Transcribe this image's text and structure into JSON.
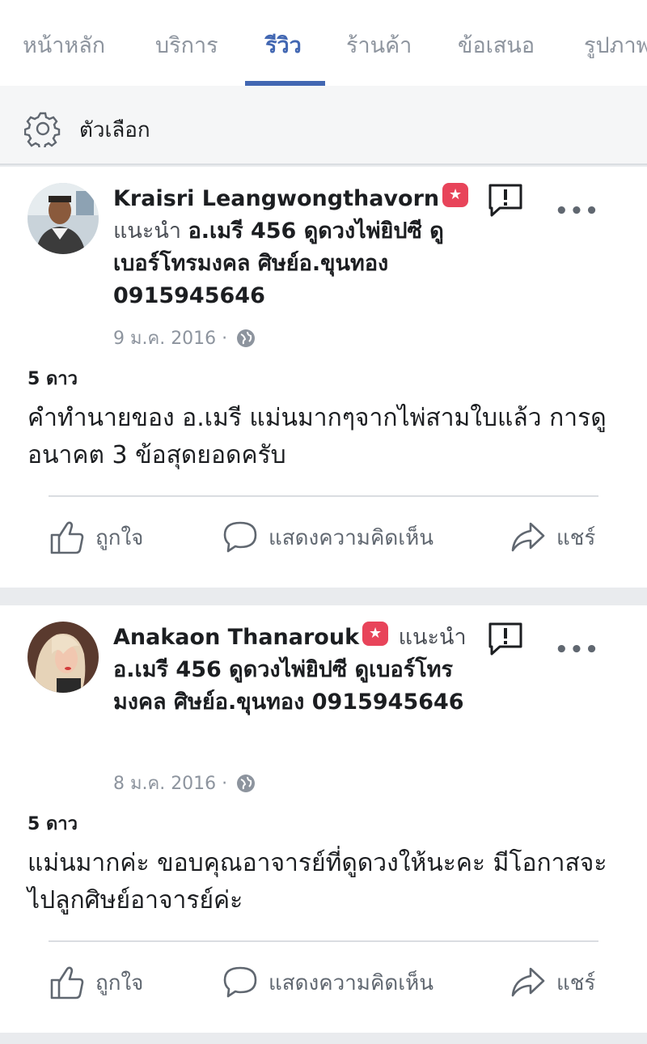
{
  "tabs": [
    "หน้าหลัก",
    "บริการ",
    "รีวิว",
    "ร้านค้า",
    "ข้อเสนอ",
    "รูปภาพ"
  ],
  "active_tab": "รีวิว",
  "options": {
    "label": "ตัวเลือก",
    "icon": "gear-icon"
  },
  "accent_color": "#4267b2",
  "badge_color": "#e8445a",
  "reviews": [
    {
      "author": "Kraisri Leangwongthavorn",
      "recommend_word": "แนะนำ",
      "page_name": "อ.เมรี 456 ดูดวงไพ่ยิปซี ดูเบอร์โทรมงคล ศิษย์อ.ขุนทอง 0915945646",
      "date": "9 ม.ค. 2016 ·",
      "rating": "5 ดาว",
      "text": "คำทำนายของ อ.เมรี แม่นมากๆจากไพ่สามใบแล้ว การดูอนาคต 3 ข้อสุดยอดครับ"
    },
    {
      "author": "Anakaon Thanarouk",
      "recommend_word": "แนะนำ",
      "page_name": "อ.เมรี 456 ดูดวงไพ่ยิปซี ดูเบอร์โทรมงคล ศิษย์อ.ขุนทอง 0915945646",
      "date": "8 ม.ค. 2016 ·",
      "rating": "5 ดาว",
      "text": "แม่นมากค่ะ ขอบคุณอาจารย์ที่ดูดวงให้นะคะ มีโอกาสจะไปลูกศิษย์อาจารย์ค่ะ"
    }
  ],
  "actions": {
    "like": "ถูกใจ",
    "comment": "แสดงความคิดเห็น",
    "share": "แชร์"
  },
  "more_label": "•••"
}
